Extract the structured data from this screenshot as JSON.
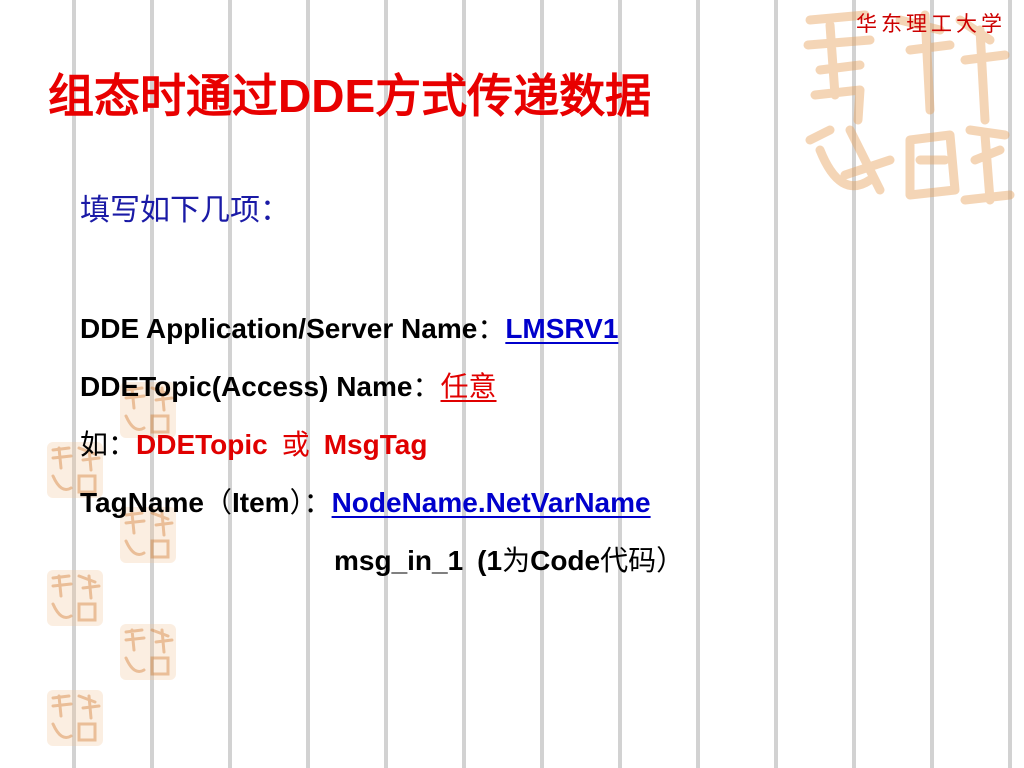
{
  "header": {
    "university": "华东理工大学"
  },
  "title": {
    "part1": "组态时通过",
    "part2": "DDE",
    "part3": "方式传递数据"
  },
  "subheading": "填写如下几项：",
  "fields": {
    "app_label": "DDE Application/Server Name",
    "app_sep": "：",
    "app_value": "LMSRV1",
    "topic_label": "DDETopic(Access) Name",
    "topic_sep": "：",
    "topic_value": "任意",
    "example_prefix": "如：",
    "example_a": "DDETopic",
    "example_or": "或",
    "example_b": "MsgTag",
    "tag_label": "TagName",
    "tag_paren_open": "（",
    "tag_item": "Item",
    "tag_paren_close": "）：",
    "tag_value": "NodeName.NetVarName",
    "msg_name": "msg_in_1",
    "msg_paren_open": "(1",
    "msg_wei": "为",
    "msg_code": "Code",
    "msg_daima": "代码",
    "msg_paren_close": "）"
  },
  "colors": {
    "title": "#e80000",
    "subheading": "#1a1aa6",
    "link": "#0000cc",
    "accent": "#e00000",
    "watermark": "#e9a05a"
  },
  "icons": {
    "watermark": "seal-calligraphy-icon"
  }
}
